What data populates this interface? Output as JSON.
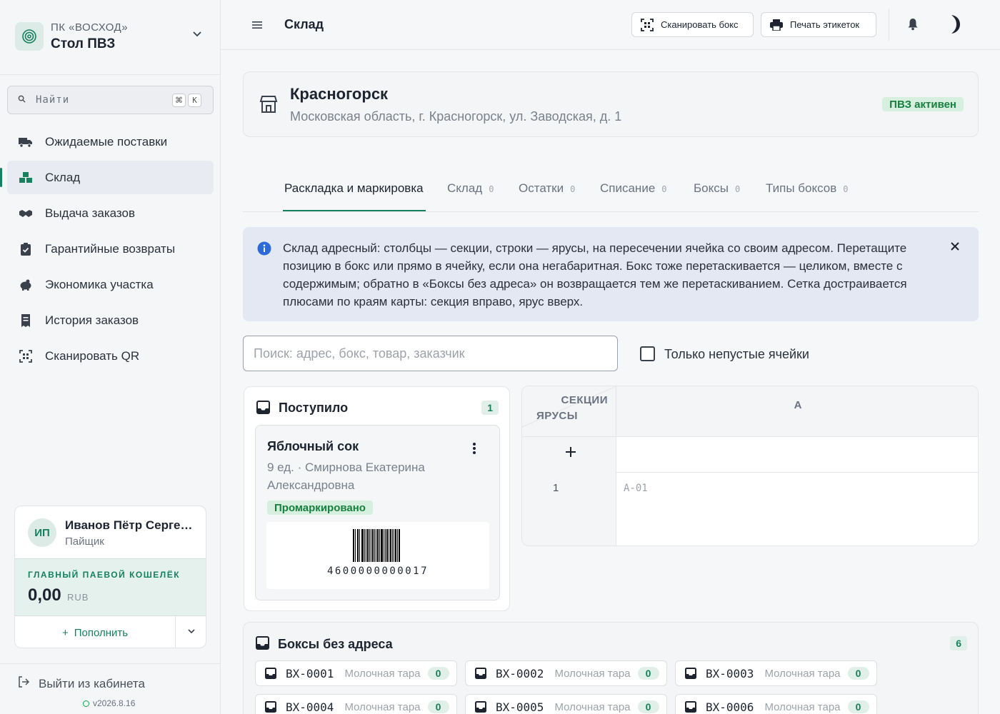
{
  "sidebar": {
    "org_subtitle": "ПК «ВОСХОД»",
    "org_title": "Стол ПВЗ",
    "search_placeholder": "Найти",
    "shortcut_mod": "⌘",
    "shortcut_key": "K",
    "items": [
      {
        "label": "Ожидаемые поставки",
        "icon": "truck-icon"
      },
      {
        "label": "Склад",
        "icon": "boxes-icon",
        "active": true
      },
      {
        "label": "Выдача заказов",
        "icon": "handshake-icon"
      },
      {
        "label": "Гарантийные возвраты",
        "icon": "clipboard-check-icon"
      },
      {
        "label": "Экономика участка",
        "icon": "piggy-bank-icon"
      },
      {
        "label": "История заказов",
        "icon": "receipt-icon"
      },
      {
        "label": "Сканировать QR",
        "icon": "qr-scan-icon"
      }
    ],
    "user": {
      "initials": "ИП",
      "name": "Иванов Пётр Сергеевич",
      "role": "Пайщик",
      "wallet_label": "ГЛАВНЫЙ ПАЕВОЙ КОШЕЛЁК",
      "wallet_amount": "0,00",
      "wallet_currency": "RUB",
      "topup_label": "Пополнить"
    },
    "logout_label": "Выйти из кабинета",
    "version": "v2026.8.16"
  },
  "header": {
    "title": "Склад",
    "scan_box_label": "Сканировать бокс",
    "print_labels_label": "Печать этикеток"
  },
  "location": {
    "title": "Красногорск",
    "address": "Московская область, г. Красногорск, ул. Заводская, д. 1",
    "status": "ПВЗ активен"
  },
  "tabs": [
    {
      "label": "Раскладка и маркировка",
      "count": ""
    },
    {
      "label": "Склад",
      "count": "0"
    },
    {
      "label": "Остатки",
      "count": "0"
    },
    {
      "label": "Списание",
      "count": "0"
    },
    {
      "label": "Боксы",
      "count": "0"
    },
    {
      "label": "Типы боксов",
      "count": "0"
    }
  ],
  "info": {
    "text": "Склад адресный: столбцы — секции, строки — ярусы, на пересечении ячейка со своим адресом. Перетащите позицию в бокс или прямо в ячейку, если она негабаритная. Бокс тоже перетаскивается — целиком, вместе с содержимым; обратно в «Боксы без адреса» он возвращается тем же перетаскиванием. Сетка достраивается плюсами по краям карты: секция вправо, ярус вверх."
  },
  "filters": {
    "search_placeholder": "Поиск: адрес, бокс, товар, заказчик",
    "search_value": "",
    "nonempty_label": "Только непустые ячейки",
    "nonempty_checked": false
  },
  "arrived": {
    "title": "Поступило",
    "count": "1",
    "item": {
      "title": "Яблочный сок",
      "meta": "9 ед. · Смирнова Екатерина Александровна",
      "status": "Промаркировано",
      "barcode": "4600000000017"
    }
  },
  "grid": {
    "sections_label": "СЕКЦИИ",
    "tiers_label": "ЯРУСЫ",
    "add_label": "+",
    "columns": [
      "А"
    ],
    "rows": [
      {
        "tier": "1",
        "cells": [
          "А-01"
        ]
      }
    ]
  },
  "unaddressed": {
    "title": "Боксы без адреса",
    "count": "6",
    "boxes": [
      {
        "code": "BX-0001",
        "type": "Молочная тара",
        "count": "0"
      },
      {
        "code": "BX-0002",
        "type": "Молочная тара",
        "count": "0"
      },
      {
        "code": "BX-0003",
        "type": "Молочная тара",
        "count": "0"
      },
      {
        "code": "BX-0004",
        "type": "Молочная тара",
        "count": "0"
      },
      {
        "code": "BX-0005",
        "type": "Молочная тара",
        "count": "0"
      },
      {
        "code": "BX-0006",
        "type": "Молочная тара",
        "count": "0"
      }
    ]
  },
  "colors": {
    "accent": "#16805f",
    "success_bg": "#d6efdf",
    "info_bg": "#e3e8f3"
  }
}
